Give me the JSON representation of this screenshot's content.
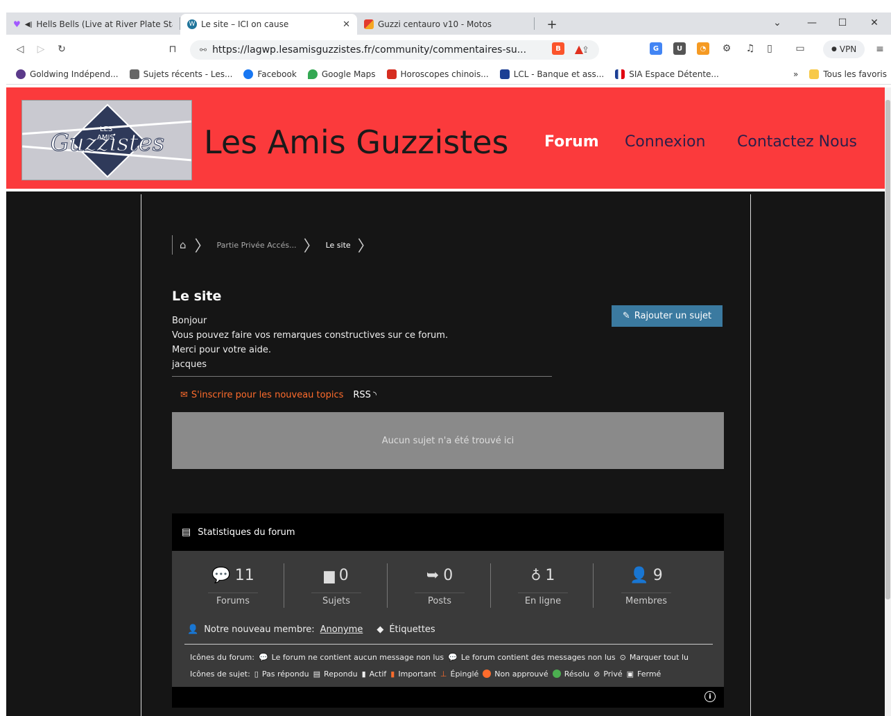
{
  "browser": {
    "tabs": [
      {
        "label": "Hells Bells (Live at River Plate Stad",
        "active": false
      },
      {
        "label": "Le site – ICI on cause",
        "active": true
      },
      {
        "label": "Guzzi centauro v10 - Motos",
        "active": false
      }
    ],
    "new_tab": "+",
    "url": "https://lagwp.lesamisguzzistes.fr/community/commentaires-su...",
    "vpn_label": "VPN",
    "bookmarks": [
      "Goldwing Indépend...",
      "Sujets récents - Les...",
      "Facebook",
      "Google Maps",
      "Horoscopes chinois...",
      "LCL - Banque et ass...",
      "SIA Espace Détente..."
    ],
    "bookmarks_more": "»",
    "all_bookmarks": "Tous les favoris"
  },
  "header": {
    "site_title": "Les Amis Guzzistes",
    "logo_text": "Les Amis Guzzistes",
    "nav": [
      {
        "label": "Forum",
        "color": "#ffffff"
      },
      {
        "label": "Connexion",
        "color": "#2a1f4a"
      },
      {
        "label": "Contactez Nous",
        "color": "#2a1f4a"
      }
    ]
  },
  "breadcrumb": {
    "items": [
      "Partie Privée Accés...",
      "Le site"
    ]
  },
  "forum": {
    "title": "Le site",
    "description": [
      "Bonjour",
      "Vous pouvez faire vos remarques constructives sur ce forum.",
      "Merci pour votre aide.",
      "jacques"
    ],
    "add_topic_label": "Rajouter un sujet",
    "subscribe_label": "S'inscrire pour les nouveau topics",
    "rss_label": "RSS",
    "no_topic_label": "Aucun sujet n'a été trouvé ici"
  },
  "stats": {
    "title": "Statistiques du forum",
    "items": [
      {
        "value": "11",
        "label": "Forums",
        "icon": "comments-icon"
      },
      {
        "value": "0",
        "label": "Sujets",
        "icon": "document-icon"
      },
      {
        "value": "0",
        "label": "Posts",
        "icon": "reply-icon"
      },
      {
        "value": "1",
        "label": "En ligne",
        "icon": "lightbulb-icon"
      },
      {
        "value": "9",
        "label": "Membres",
        "icon": "user-icon"
      }
    ],
    "new_member_prefix": "Notre nouveau membre:",
    "new_member_name": "Anonyme",
    "tags_label": "Étiquettes",
    "forum_icons_label": "Icônes du forum:",
    "forum_icons": [
      "Le forum ne contient aucun message non lus",
      "Le forum contient des messages non lus",
      "Marquer tout lu"
    ],
    "topic_icons_label": "Icônes de sujet:",
    "topic_icons": [
      "Pas répondu",
      "Repondu",
      "Actif",
      "Important",
      "Épinglé",
      "Non approuvé",
      "Résolu",
      "Privé",
      "Fermé"
    ]
  },
  "colors": {
    "header_red": "#fb3a3c",
    "accent_orange": "#ff6c2c",
    "button_blue": "#3b7aa0"
  }
}
